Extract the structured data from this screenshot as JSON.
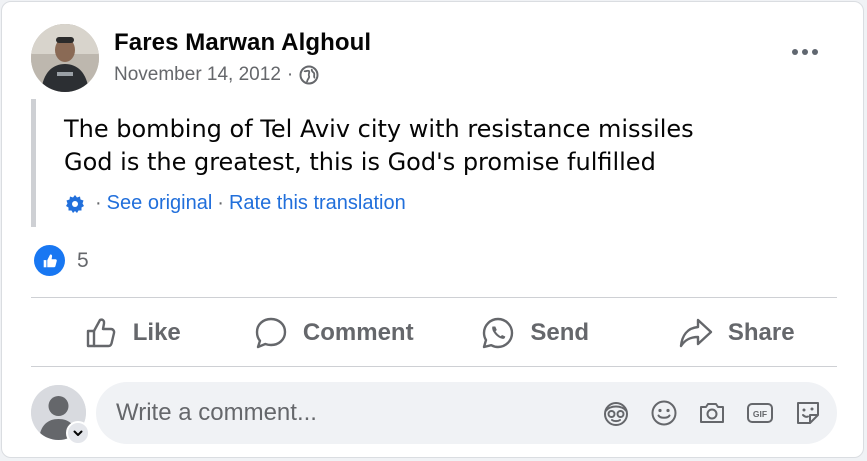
{
  "post": {
    "author": "Fares Marwan Alghoul",
    "date": "November 14, 2012",
    "separator": "·",
    "audience_icon": "globe-icon",
    "text_lines": [
      "The bombing of Tel Aviv city with resistance missiles",
      "God is the greatest, this is God's promise fulfilled"
    ],
    "translation": {
      "settings_icon": "gear-icon",
      "see_original": "See original",
      "rate": "Rate this translation",
      "separator": "·"
    }
  },
  "reactions": {
    "icon": "like-icon",
    "count": "5"
  },
  "actions": {
    "like": "Like",
    "comment": "Comment",
    "send": "Send",
    "share": "Share"
  },
  "composer": {
    "placeholder": "Write a comment...",
    "icons": [
      "avatar-sticker-icon",
      "emoji-icon",
      "camera-icon",
      "gif-icon",
      "sticker-icon"
    ]
  },
  "colors": {
    "link": "#216fdb",
    "accent": "#1877f2",
    "secondary_text": "#65676b"
  }
}
